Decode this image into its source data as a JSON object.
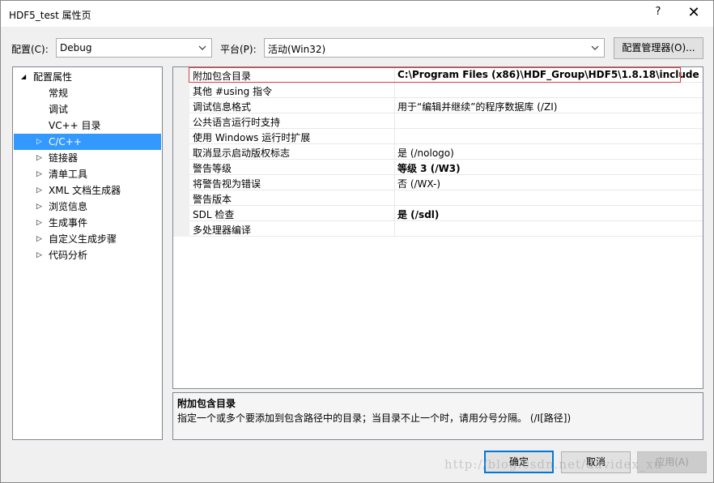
{
  "window": {
    "title": "HDF5_test 属性页",
    "help_label": "?",
    "close_label": "✕"
  },
  "toolbar": {
    "config_label": "配置(C):",
    "config_value": "Debug",
    "platform_label": "平台(P):",
    "platform_value": "活动(Win32)",
    "config_manager_label": "配置管理器(O)..."
  },
  "tree": {
    "items": [
      {
        "label": "配置属性",
        "expander": "◢"
      },
      {
        "label": "常规",
        "expander": ""
      },
      {
        "label": "调试",
        "expander": ""
      },
      {
        "label": "VC++ 目录",
        "expander": ""
      },
      {
        "label": "C/C++",
        "expander": "▷"
      },
      {
        "label": "链接器",
        "expander": "▷"
      },
      {
        "label": "清单工具",
        "expander": "▷"
      },
      {
        "label": "XML 文档生成器",
        "expander": "▷"
      },
      {
        "label": "浏览信息",
        "expander": "▷"
      },
      {
        "label": "生成事件",
        "expander": "▷"
      },
      {
        "label": "自定义生成步骤",
        "expander": "▷"
      },
      {
        "label": "代码分析",
        "expander": "▷"
      }
    ]
  },
  "grid": {
    "rows": [
      {
        "name": "附加包含目录",
        "value": "C:\\Program Files (x86)\\HDF_Group\\HDF5\\1.8.18\\include",
        "bold": true
      },
      {
        "name": "其他 #using 指令",
        "value": "",
        "bold": false
      },
      {
        "name": "调试信息格式",
        "value": "用于“编辑并继续”的程序数据库 (/ZI)",
        "bold": false
      },
      {
        "name": "公共语言运行时支持",
        "value": "",
        "bold": false
      },
      {
        "name": "使用 Windows 运行时扩展",
        "value": "",
        "bold": false
      },
      {
        "name": "取消显示启动版权标志",
        "value": "是 (/nologo)",
        "bold": false
      },
      {
        "name": "警告等级",
        "value": "等级 3 (/W3)",
        "bold": true
      },
      {
        "name": "将警告视为错误",
        "value": "否 (/WX-)",
        "bold": false
      },
      {
        "name": "警告版本",
        "value": "",
        "bold": false
      },
      {
        "name": "SDL 检查",
        "value": "是 (/sdl)",
        "bold": true
      },
      {
        "name": "多处理器编译",
        "value": "",
        "bold": false
      }
    ]
  },
  "description": {
    "title": "附加包含目录",
    "text": "指定一个或多个要添加到包含路径中的目录；当目录不止一个时，请用分号分隔。      (/I[路径])"
  },
  "buttons": {
    "ok": "确定",
    "cancel": "取消",
    "apply": "应用(A)"
  },
  "watermark": "http://blog.csdn.net/davidex_xu",
  "colors": {
    "selection": "#3399ff",
    "highlight_box": "#e0393b",
    "default_button_border": "#0078d7"
  }
}
